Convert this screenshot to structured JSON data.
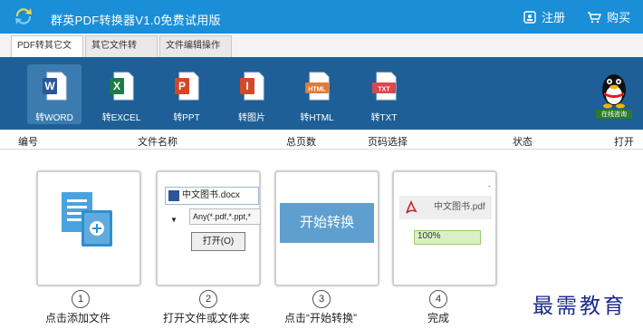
{
  "titlebar": {
    "title": "群英PDF转换器V1.0免费试用版",
    "register_label": "注册",
    "buy_label": "购买"
  },
  "tabs": [
    {
      "label": "PDF转其它文件",
      "active": true
    },
    {
      "label": "其它文件转PDF",
      "active": false
    },
    {
      "label": "文件编辑操作",
      "active": false
    }
  ],
  "tools": [
    {
      "label": "转WORD",
      "icon": "word-icon",
      "badge": "W",
      "color": "#2b579a",
      "active": true
    },
    {
      "label": "转EXCEL",
      "icon": "excel-icon",
      "badge": "X",
      "color": "#1e7b45",
      "active": false
    },
    {
      "label": "转PPT",
      "icon": "ppt-icon",
      "badge": "P",
      "color": "#d24726",
      "active": false
    },
    {
      "label": "转图片",
      "icon": "image-icon",
      "badge": "I",
      "color": "#d04a2c",
      "active": false
    },
    {
      "label": "转HTML",
      "icon": "html-icon",
      "badge": "HTML",
      "color": "#e07a3a",
      "active": false
    },
    {
      "label": "转TXT",
      "icon": "txt-icon",
      "badge": "TXT",
      "color": "#d9484d",
      "active": false
    }
  ],
  "qq": {
    "label": "在线咨询"
  },
  "columns": [
    "编号",
    "文件名称",
    "总页数",
    "页码选择",
    "状态",
    "打开"
  ],
  "steps": [
    {
      "num": "1",
      "label": "点击添加文件"
    },
    {
      "num": "2",
      "label": "打开文件或文件夹"
    },
    {
      "num": "3",
      "label": "点击“开始转换”"
    },
    {
      "num": "4",
      "label": "完成"
    }
  ],
  "card2": {
    "filename": "中文图书.docx",
    "filter": "Any(*.pdf,*.ppt,*",
    "open_button": "打开(O)"
  },
  "card3": {
    "start_button": "开始转换"
  },
  "card4": {
    "filename": "中文图书.pdf",
    "progress_text": "100%",
    "progress": 1.0,
    "corner": "-"
  },
  "watermark": "最需教育"
}
